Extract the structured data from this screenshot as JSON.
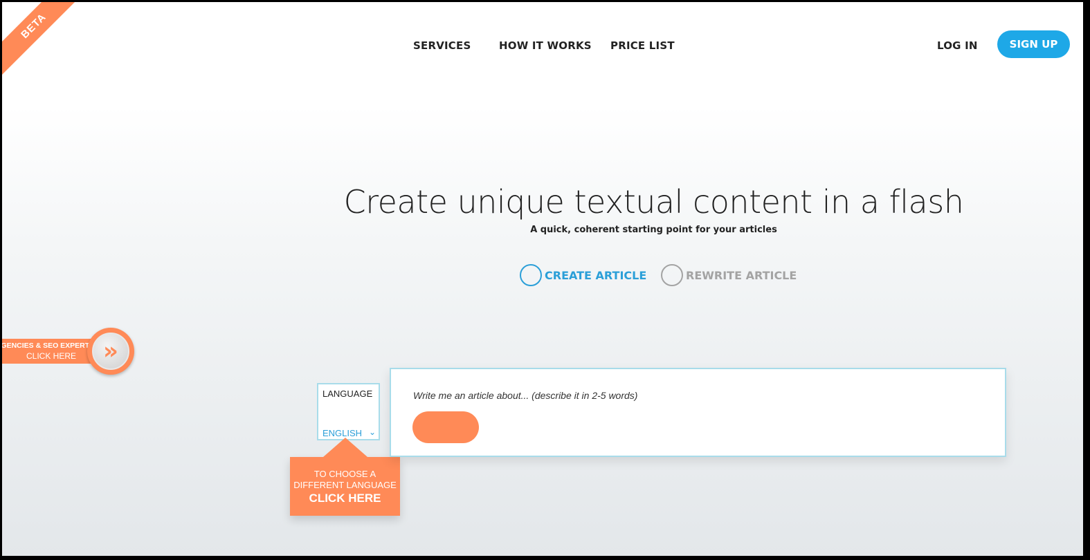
{
  "beta_label": "BETA",
  "nav": {
    "items": [
      {
        "label": "SERVICES"
      },
      {
        "label": "HOW IT WORKS"
      },
      {
        "label": "PRICE LIST"
      }
    ],
    "login_label": "LOG IN",
    "signup_label": "SIGN UP"
  },
  "hero": {
    "title": "Create unique textual content in a flash",
    "subtitle": "A quick, coherent starting point for your articles"
  },
  "mode_options": {
    "create": "CREATE ARTICLE",
    "rewrite": "REWRITE ARTICLE",
    "selected": "create"
  },
  "agency_tab": {
    "line1": "AGENCIES & SEO EXPERTS",
    "line2": "CLICK HERE",
    "icon": "double-chevron-right-icon",
    "icon_glyph": "»"
  },
  "language": {
    "label": "LANGUAGE",
    "value": "ENGLISH",
    "chevron_glyph": "⌄",
    "callout_line1": "TO CHOOSE A",
    "callout_line2": "DIFFERENT LANGUAGE",
    "callout_cta": "CLICK HERE"
  },
  "article": {
    "placeholder": "Write me an article about... (describe it in 2-5 words)",
    "value": ""
  },
  "colors": {
    "accent_orange": "#ff8a57",
    "accent_blue": "#1ea8e7",
    "border_blue": "#a8dcea"
  }
}
